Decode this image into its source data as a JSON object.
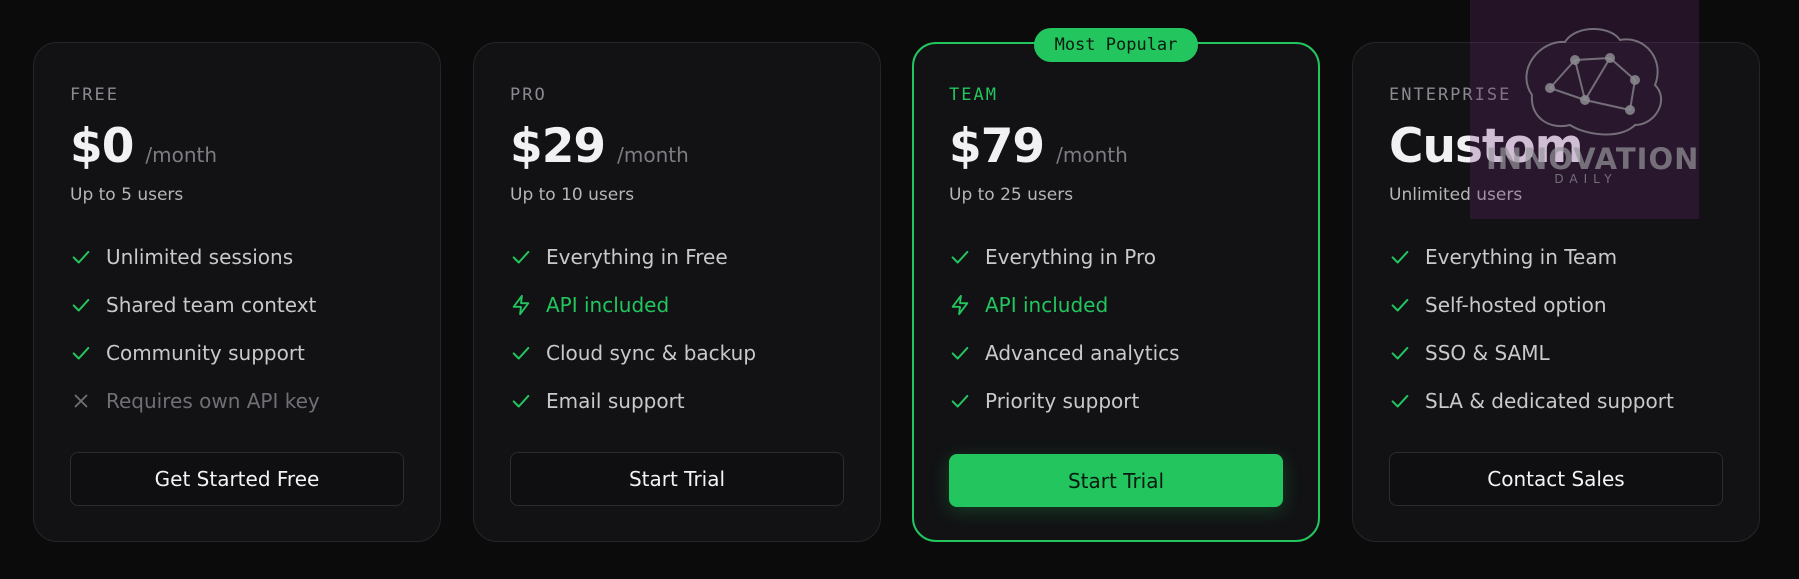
{
  "plans": [
    {
      "tier": "FREE",
      "price": "$0",
      "period": "/month",
      "users": "Up to 5 users",
      "features": [
        {
          "text": "Unlimited sessions",
          "icon": "check-icon",
          "style": "normal"
        },
        {
          "text": "Shared team context",
          "icon": "check-icon",
          "style": "normal"
        },
        {
          "text": "Community support",
          "icon": "check-icon",
          "style": "normal"
        },
        {
          "text": "Requires own API key",
          "icon": "x-icon",
          "style": "muted"
        }
      ],
      "cta": "Get Started Free"
    },
    {
      "tier": "PRO",
      "price": "$29",
      "period": "/month",
      "users": "Up to 10 users",
      "features": [
        {
          "text": "Everything in Free",
          "icon": "check-icon",
          "style": "normal"
        },
        {
          "text": "API included",
          "icon": "bolt-icon",
          "style": "accent"
        },
        {
          "text": "Cloud sync & backup",
          "icon": "check-icon",
          "style": "normal"
        },
        {
          "text": "Email support",
          "icon": "check-icon",
          "style": "normal"
        }
      ],
      "cta": "Start Trial"
    },
    {
      "tier": "TEAM",
      "price": "$79",
      "period": "/month",
      "users": "Up to 25 users",
      "badge": "Most Popular",
      "features": [
        {
          "text": "Everything in Pro",
          "icon": "check-icon",
          "style": "normal"
        },
        {
          "text": "API included",
          "icon": "bolt-icon",
          "style": "accent"
        },
        {
          "text": "Advanced analytics",
          "icon": "check-icon",
          "style": "normal"
        },
        {
          "text": "Priority support",
          "icon": "check-icon",
          "style": "normal"
        }
      ],
      "cta": "Start Trial"
    },
    {
      "tier": "ENTERPRISE",
      "price": "Custom",
      "period": "",
      "users": "Unlimited users",
      "features": [
        {
          "text": "Everything in Team",
          "icon": "check-icon",
          "style": "normal"
        },
        {
          "text": "Self-hosted option",
          "icon": "check-icon",
          "style": "normal"
        },
        {
          "text": "SSO & SAML",
          "icon": "check-icon",
          "style": "normal"
        },
        {
          "text": "SLA & dedicated support",
          "icon": "check-icon",
          "style": "normal"
        }
      ],
      "cta": "Contact Sales"
    }
  ],
  "watermark": {
    "title": "INNOVATION",
    "subtitle": "DAILY",
    "icon": "brain-network-icon"
  },
  "colors": {
    "accent": "#22c55e",
    "background": "#0b0b0c",
    "card": "#121214"
  }
}
